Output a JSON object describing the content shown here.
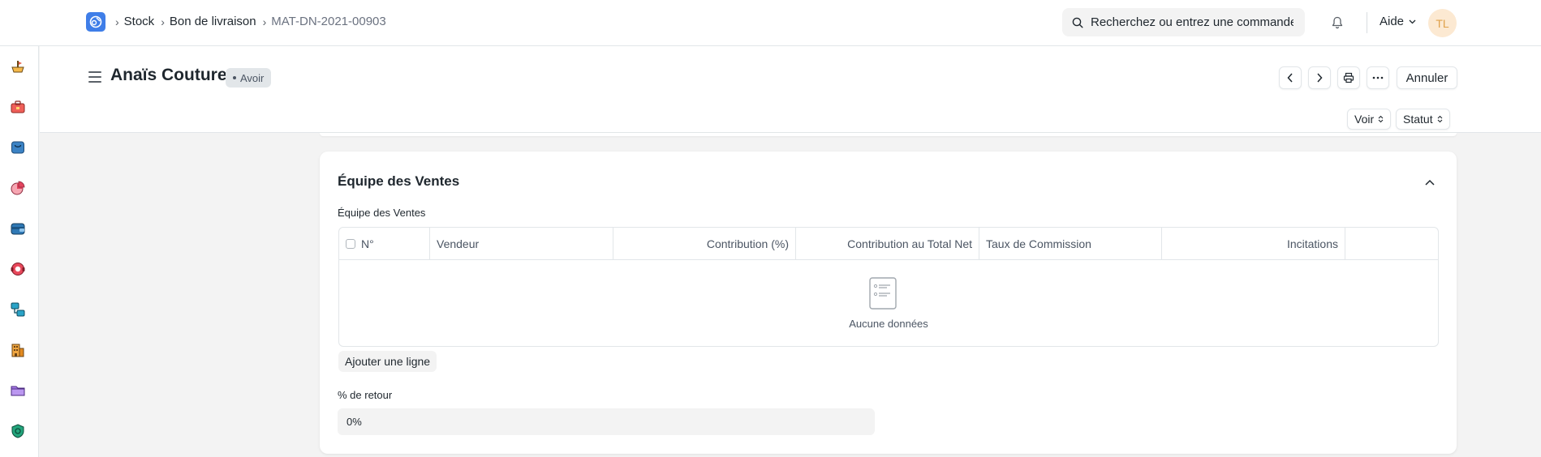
{
  "navbar": {
    "breadcrumbs": [
      "Stock",
      "Bon de livraison",
      "MAT-DN-2021-00903"
    ],
    "search_placeholder": "Recherchez ou entrez une commande",
    "help_label": "Aide",
    "avatar_initials": "TL"
  },
  "sidebar": {
    "icons": [
      "stock-icon",
      "toolbox-icon",
      "shopping-bag-icon",
      "pie-chart-icon",
      "wallet-icon",
      "support-icon",
      "flow-icon",
      "building-icon",
      "folder-icon",
      "shield-icon"
    ]
  },
  "page": {
    "title": "Anaïs Couture",
    "status": "Avoir",
    "cancel_label": "Annuler",
    "view_label": "Voir",
    "status_select_label": "Statut"
  },
  "section": {
    "title": "Équipe des Ventes",
    "table_label": "Équipe des Ventes",
    "columns": [
      "N°",
      "Vendeur",
      "Contribution (%)",
      "Contribution au Total Net",
      "Taux de Commission",
      "Incitations"
    ],
    "empty_text": "Aucune données",
    "add_row_label": "Ajouter une ligne",
    "return_label": "% de retour",
    "return_value": "0%"
  },
  "colors": {
    "accent": "#3f7ee8",
    "avatar_bg": "#fce9d2",
    "avatar_text": "#e0a24c"
  }
}
